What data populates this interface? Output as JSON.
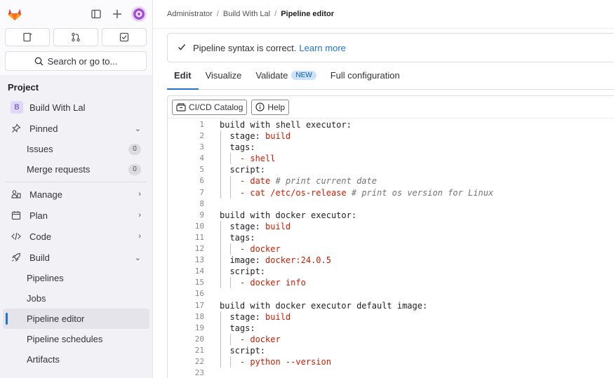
{
  "sidebar": {
    "section_title": "Project",
    "project": {
      "initial": "B",
      "name": "Build With Lal"
    },
    "search_label": "Search or go to...",
    "items": {
      "pinned": "Pinned",
      "issues": "Issues",
      "issues_count": "0",
      "merge_requests": "Merge requests",
      "mr_count": "0",
      "manage": "Manage",
      "plan": "Plan",
      "code": "Code",
      "build": "Build",
      "pipelines": "Pipelines",
      "jobs": "Jobs",
      "pipeline_editor": "Pipeline editor",
      "pipeline_schedules": "Pipeline schedules",
      "artifacts": "Artifacts"
    }
  },
  "breadcrumb": [
    "Administrator",
    "Build With Lal",
    "Pipeline editor"
  ],
  "alert": {
    "text": "Pipeline syntax is correct.",
    "link": "Learn more"
  },
  "tabs": {
    "edit": "Edit",
    "visualize": "Visualize",
    "validate": "Validate",
    "new_badge": "NEW",
    "full": "Full configuration"
  },
  "toolbar": {
    "catalog": "CI/CD Catalog",
    "help": "Help"
  },
  "code_lines": [
    "build with shell executor:",
    "  stage: build",
    "  tags:",
    "    - shell",
    "  script:",
    "    - date # print current date",
    "    - cat /etc/os-release # print os version for Linux",
    "",
    "build with docker executor:",
    "  stage: build",
    "  tags:",
    "    - docker",
    "  image: docker:24.0.5",
    "  script:",
    "    - docker info",
    "",
    "build with docker executor default image:",
    "  stage: build",
    "  tags:",
    "    - docker",
    "  script:",
    "    - python --version",
    ""
  ]
}
